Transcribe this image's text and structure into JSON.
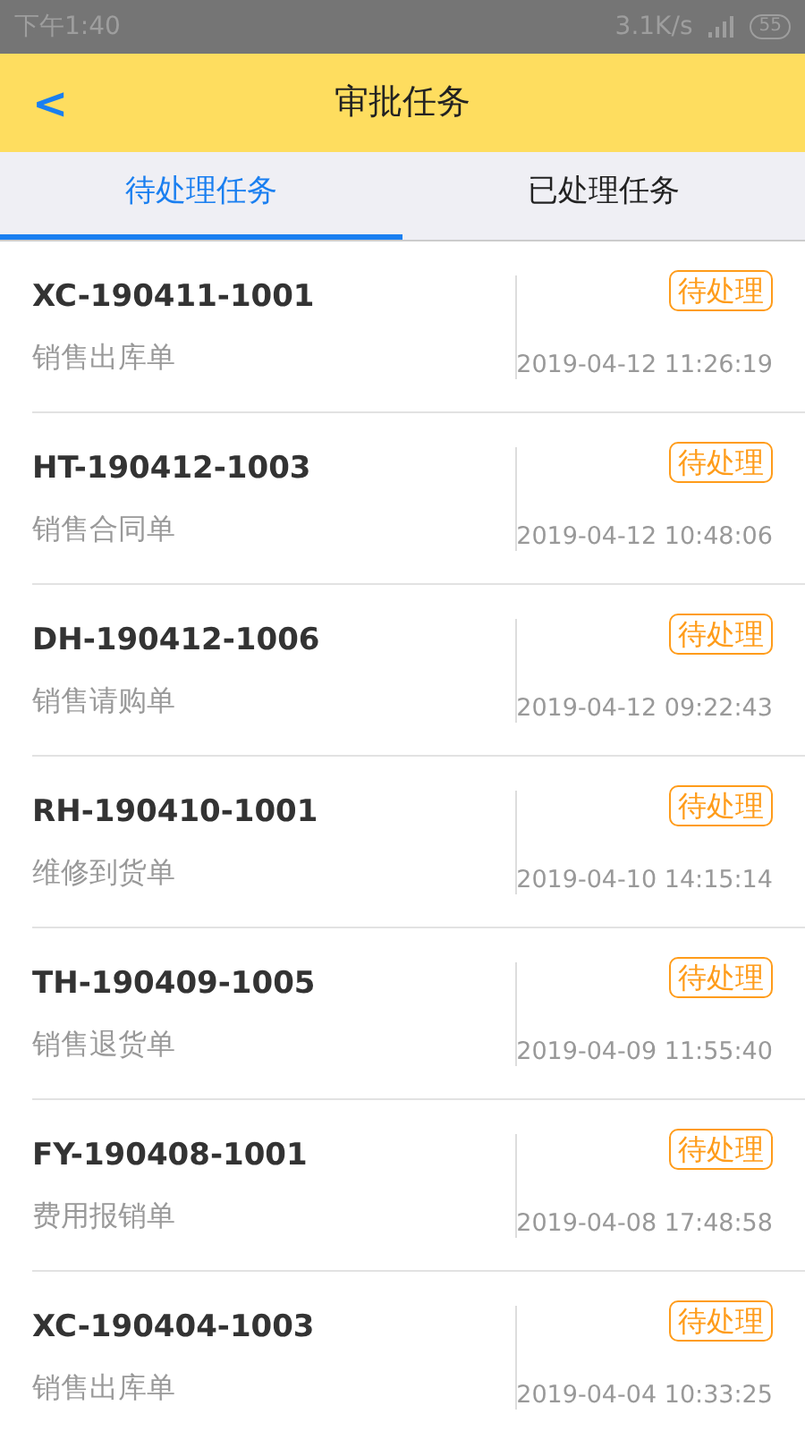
{
  "status_bar": {
    "time": "下午1:40",
    "speed": "3.1K/s",
    "battery": "55"
  },
  "header": {
    "back": "<",
    "title": "审批任务"
  },
  "tabs": [
    {
      "label": "待处理任务",
      "selected": true
    },
    {
      "label": "已处理任务",
      "selected": false
    }
  ],
  "tasks": [
    {
      "code": "XC-190411-1001",
      "type": "销售出库单",
      "status": "待处理",
      "time": "2019-04-12 11:26:19"
    },
    {
      "code": "HT-190412-1003",
      "type": "销售合同单",
      "status": "待处理",
      "time": "2019-04-12 10:48:06"
    },
    {
      "code": "DH-190412-1006",
      "type": "销售请购单",
      "status": "待处理",
      "time": "2019-04-12 09:22:43"
    },
    {
      "code": "RH-190410-1001",
      "type": "维修到货单",
      "status": "待处理",
      "time": "2019-04-10 14:15:14"
    },
    {
      "code": "TH-190409-1005",
      "type": "销售退货单",
      "status": "待处理",
      "time": "2019-04-09 11:55:40"
    },
    {
      "code": "FY-190408-1001",
      "type": "费用报销单",
      "status": "待处理",
      "time": "2019-04-08 17:48:58"
    },
    {
      "code": "XC-190404-1003",
      "type": "销售出库单",
      "status": "待处理",
      "time": "2019-04-04 10:33:25"
    }
  ]
}
